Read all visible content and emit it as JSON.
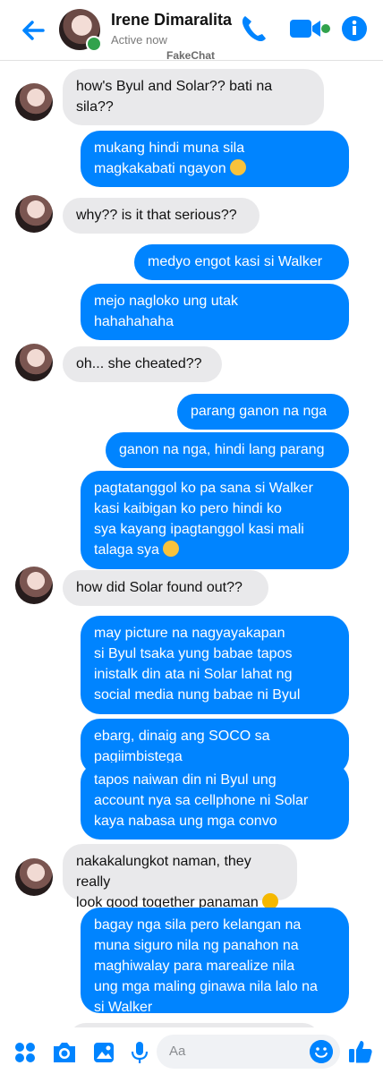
{
  "header": {
    "name": "Irene Dimaralita",
    "status": "Active now",
    "watermark": "FakeChat",
    "accent": "#0084ff"
  },
  "messages": [
    {
      "from": "them",
      "text": "how's Byul and Solar?? bati na\nsila??"
    },
    {
      "from": "me",
      "text": "mukang hindi muna sila\nmagkakabati ngayon"
    },
    {
      "from": "them",
      "text": "why?? is it that serious??"
    },
    {
      "from": "me",
      "text": "medyo engot kasi si Walker"
    },
    {
      "from": "me",
      "text": "mejo nagloko ung utak\nhahahahaha"
    },
    {
      "from": "them",
      "text": "oh... she cheated??"
    },
    {
      "from": "me",
      "text": "parang ganon na nga"
    },
    {
      "from": "me",
      "text": "ganon na nga, hindi lang parang"
    },
    {
      "from": "me",
      "text": "pagtatanggol ko pa sana si Walker\nkasi kaibigan ko pero hindi ko\nsya kayang ipagtanggol kasi mali\ntalaga sya"
    },
    {
      "from": "them",
      "text": "how did Solar found out??"
    },
    {
      "from": "me",
      "text": "may picture na nagyayakapan\nsi Byul tsaka yung babae tapos\ninistalk din ata ni Solar lahat ng\nsocial media nung babae ni Byul"
    },
    {
      "from": "me",
      "text": "ebarg, dinaig ang SOCO sa\npagiimbistega"
    },
    {
      "from": "me",
      "text": "tapos naiwan din ni Byul ung\naccount nya sa cellphone ni Solar\nkaya nabasa ung mga convo"
    },
    {
      "from": "them",
      "text": "nakakalungkot naman, they really\nlook good together panaman"
    },
    {
      "from": "me",
      "text": "bagay nga sila pero kelangan na\nmuna siguro nila ng panahon na\nmaghiwalay para marealize nila\nung mga maling ginawa nila lalo na\nsi Walker"
    }
  ],
  "composer": {
    "placeholder": "Aa"
  },
  "icons": [
    "back-arrow-icon",
    "phone-icon",
    "video-icon",
    "info-icon",
    "apps-icon",
    "camera-icon",
    "gallery-icon",
    "mic-icon",
    "emoji-icon",
    "thumbs-up-icon"
  ]
}
